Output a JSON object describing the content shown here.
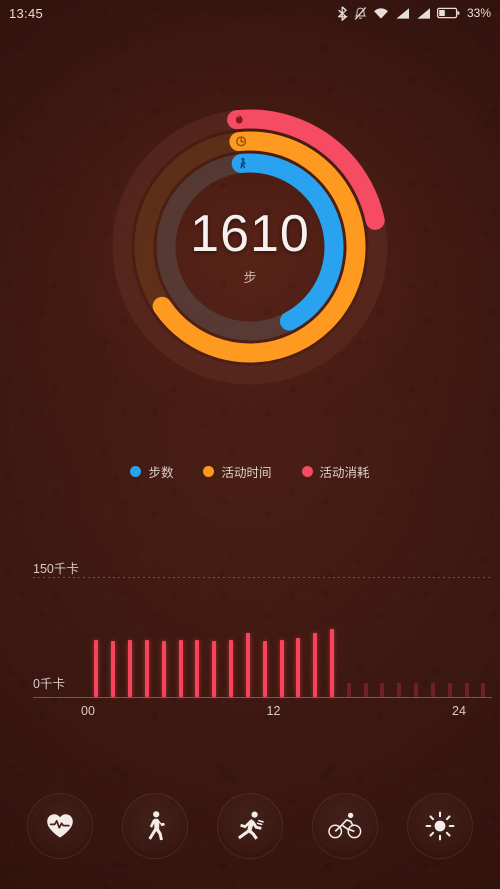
{
  "statusbar": {
    "time": "13:45",
    "battery_percent": "33%",
    "icons": [
      "bluetooth-icon",
      "silent-mode-icon",
      "wifi-icon",
      "signal-sim1-icon",
      "signal-sim2-icon",
      "battery-icon"
    ]
  },
  "rings": {
    "center_value": "1610",
    "center_unit": "步",
    "arcs": [
      {
        "name": "activity-calories-ring",
        "icon": "flame-icon",
        "color": "#f54b63",
        "track_color": "#5e2b24",
        "radius": 128,
        "stroke": 19,
        "start_deg": -6,
        "sweep_deg": 84
      },
      {
        "name": "activity-time-ring",
        "icon": "clock-icon",
        "color": "#ff9a20",
        "track_color": "#6b3a1c",
        "radius": 106,
        "stroke": 19,
        "start_deg": -6,
        "sweep_deg": 242
      },
      {
        "name": "steps-ring",
        "icon": "walk-icon",
        "color": "#29a3f0",
        "track_color": "#5a4a46",
        "radius": 84,
        "stroke": 19,
        "start_deg": -6,
        "sweep_deg": 158
      }
    ]
  },
  "legend": {
    "items": [
      {
        "label": "步数",
        "color": "#29a3f0",
        "name": "legend-steps"
      },
      {
        "label": "活动时间",
        "color": "#ff9a20",
        "name": "legend-activity-time"
      },
      {
        "label": "活动消耗",
        "color": "#f54b63",
        "name": "legend-activity-calories"
      }
    ]
  },
  "chart_data": {
    "type": "bar",
    "title": "",
    "xlabel": "",
    "ylabel": "千卡",
    "ylim": [
      0,
      150
    ],
    "grid": true,
    "legend_position": "none",
    "top_label": "150千卡",
    "zero_label": "0千卡",
    "xtick_labels": [
      "00",
      "12",
      "24"
    ],
    "xtick_values": [
      0,
      12,
      24
    ],
    "bar_color": "#f8435c",
    "inactive_bar_color": "#6d2026",
    "categories": [
      "0",
      "1",
      "2",
      "3",
      "4",
      "5",
      "6",
      "7",
      "8",
      "9",
      "10",
      "11",
      "12",
      "13",
      "14",
      "15",
      "16",
      "17",
      "18",
      "19",
      "20",
      "21",
      "22",
      "23"
    ],
    "values": [
      48,
      47,
      48,
      48,
      47,
      48,
      48,
      47,
      48,
      54,
      47,
      48,
      50,
      54,
      57,
      12,
      12,
      12,
      12,
      12,
      12,
      12,
      12,
      12
    ],
    "active_hours": 15,
    "series": [
      {
        "name": "活动消耗",
        "values": [
          48,
          47,
          48,
          48,
          47,
          48,
          48,
          47,
          48,
          54,
          47,
          48,
          50,
          54,
          57,
          12,
          12,
          12,
          12,
          12,
          12,
          12,
          12,
          12
        ]
      }
    ]
  },
  "bottomnav": {
    "items": [
      {
        "name": "nav-heart-rate",
        "icon": "heart-rate-icon"
      },
      {
        "name": "nav-walking",
        "icon": "walking-icon"
      },
      {
        "name": "nav-running",
        "icon": "running-icon"
      },
      {
        "name": "nav-cycling",
        "icon": "cycling-icon"
      },
      {
        "name": "nav-brightness",
        "icon": "sun-icon"
      }
    ]
  }
}
